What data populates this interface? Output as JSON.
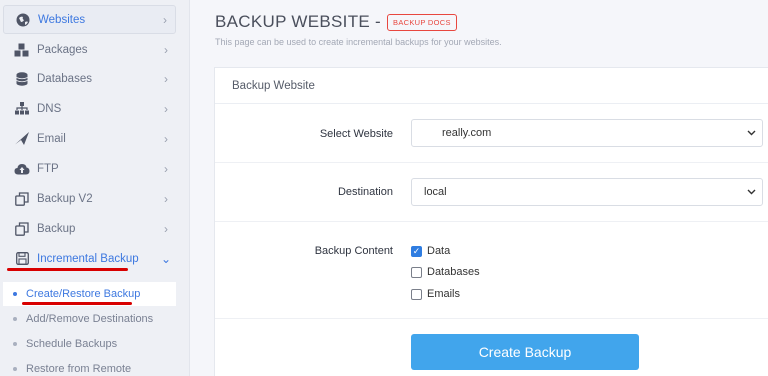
{
  "sidebar": {
    "items": [
      {
        "label": "Websites",
        "icon": "globe-icon"
      },
      {
        "label": "Packages",
        "icon": "cubes-icon"
      },
      {
        "label": "Databases",
        "icon": "database-icon"
      },
      {
        "label": "DNS",
        "icon": "sitemap-icon"
      },
      {
        "label": "Email",
        "icon": "paper-plane-icon"
      },
      {
        "label": "FTP",
        "icon": "cloud-upload-icon"
      },
      {
        "label": "Backup V2",
        "icon": "copy-icon"
      },
      {
        "label": "Backup",
        "icon": "copy-icon"
      },
      {
        "label": "Incremental Backup",
        "icon": "save-icon"
      }
    ],
    "sub_items": [
      {
        "label": "Create/Restore Backup"
      },
      {
        "label": "Add/Remove Destinations"
      },
      {
        "label": "Schedule Backups"
      },
      {
        "label": "Restore from Remote"
      }
    ]
  },
  "header": {
    "title": "BACKUP WEBSITE -",
    "docs_badge": "BACKUP DOCS",
    "subtitle": "This page can be used to create incremental backups for your websites."
  },
  "form": {
    "card_title": "Backup Website",
    "select_website": {
      "label": "Select Website",
      "value": "really.com"
    },
    "destination": {
      "label": "Destination",
      "value": "local"
    },
    "backup_content": {
      "label": "Backup Content",
      "options": [
        {
          "label": "Data",
          "checked": true
        },
        {
          "label": "Databases",
          "checked": false
        },
        {
          "label": "Emails",
          "checked": false
        }
      ]
    },
    "submit_label": "Create Backup"
  },
  "colors": {
    "accent": "#3d78e0",
    "button": "#41a5ec",
    "badge": "#e8473f",
    "annotation": "#d80000"
  }
}
